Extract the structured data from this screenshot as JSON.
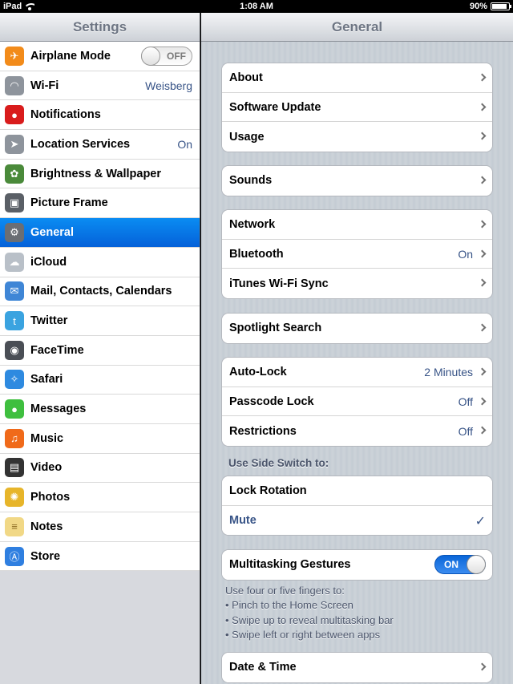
{
  "status_bar": {
    "device": "iPad",
    "time": "1:08 AM",
    "battery": "90%",
    "battery_level": 0.9
  },
  "sidebar": {
    "title": "Settings",
    "items": [
      {
        "label": "Airplane Mode",
        "icon": "airplane-icon",
        "color": "#f28b1a",
        "toggle": "OFF"
      },
      {
        "label": "Wi-Fi",
        "icon": "wifi-icon",
        "color": "#8e949c",
        "value": "Weisberg"
      },
      {
        "label": "Notifications",
        "icon": "notifications-icon",
        "color": "#d91c1c"
      },
      {
        "label": "Location Services",
        "icon": "location-arrow-icon",
        "color": "#8e949c",
        "value": "On"
      },
      {
        "label": "Brightness & Wallpaper",
        "icon": "flower-icon",
        "color": "#4a8a3a"
      },
      {
        "label": "Picture Frame",
        "icon": "picture-frame-icon",
        "color": "#5a5f66"
      },
      {
        "label": "General",
        "icon": "gear-icon",
        "color": "#6a6e74",
        "selected": true
      },
      {
        "label": "iCloud",
        "icon": "cloud-icon",
        "color": "#b9c0c8"
      },
      {
        "label": "Mail, Contacts, Calendars",
        "icon": "mail-icon",
        "color": "#3f86d6"
      },
      {
        "label": "Twitter",
        "icon": "twitter-icon",
        "color": "#3aa3e0"
      },
      {
        "label": "FaceTime",
        "icon": "facetime-icon",
        "color": "#4a4e55"
      },
      {
        "label": "Safari",
        "icon": "compass-icon",
        "color": "#2e8ae0"
      },
      {
        "label": "Messages",
        "icon": "speech-bubble-icon",
        "color": "#3fbf3f"
      },
      {
        "label": "Music",
        "icon": "music-note-icon",
        "color": "#f06a1a"
      },
      {
        "label": "Video",
        "icon": "film-clapper-icon",
        "color": "#333333"
      },
      {
        "label": "Photos",
        "icon": "sunflower-icon",
        "color": "#e7b52a"
      },
      {
        "label": "Notes",
        "icon": "notepad-icon",
        "color": "#f1d886"
      },
      {
        "label": "Store",
        "icon": "app-store-icon",
        "color": "#2f7fe0"
      }
    ]
  },
  "main": {
    "title": "General",
    "group1": [
      {
        "label": "About"
      },
      {
        "label": "Software Update"
      },
      {
        "label": "Usage"
      }
    ],
    "group2": [
      {
        "label": "Sounds"
      }
    ],
    "group3": [
      {
        "label": "Network"
      },
      {
        "label": "Bluetooth",
        "value": "On"
      },
      {
        "label": "iTunes Wi-Fi Sync"
      }
    ],
    "group4": [
      {
        "label": "Spotlight Search"
      }
    ],
    "group5": [
      {
        "label": "Auto-Lock",
        "value": "2 Minutes"
      },
      {
        "label": "Passcode Lock",
        "value": "Off"
      },
      {
        "label": "Restrictions",
        "value": "Off"
      }
    ],
    "side_switch": {
      "header": "Use Side Switch to:",
      "options": [
        {
          "label": "Lock Rotation"
        },
        {
          "label": "Mute",
          "checked": true
        }
      ]
    },
    "multitasking": {
      "label": "Multitasking Gestures",
      "toggle": "ON",
      "footer": [
        "Use four or five fingers to:",
        "• Pinch to the Home Screen",
        "• Swipe up to reveal multitasking bar",
        "• Swipe left or right between apps"
      ]
    },
    "group_last": [
      {
        "label": "Date & Time"
      }
    ]
  }
}
